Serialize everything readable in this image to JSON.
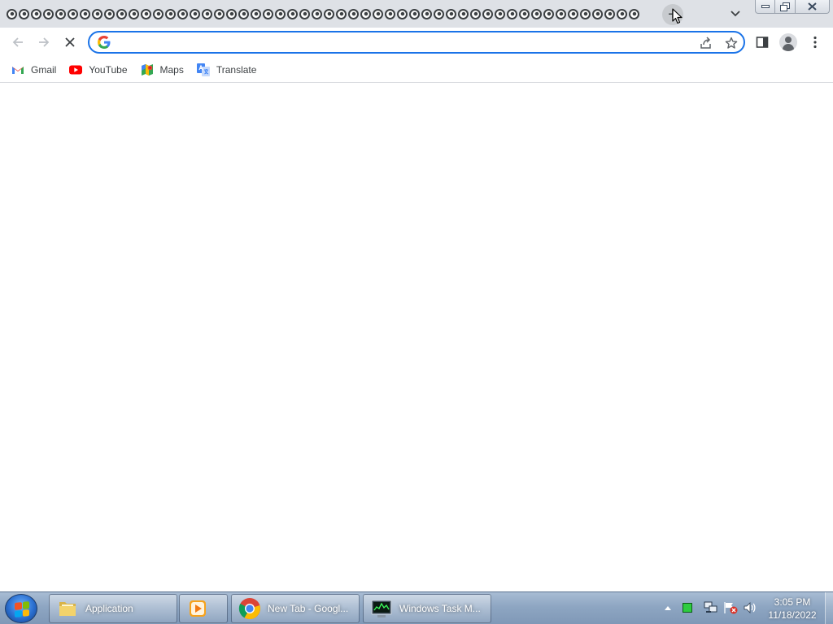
{
  "browser": {
    "tab_count": 52,
    "tab_icon": "tab-favicon-icon",
    "newtab_label": "+",
    "omnibox": {
      "value": "",
      "placeholder": ""
    },
    "colors": {
      "omnibox_focus": "#1a73e8",
      "tabstrip_bg": "#dee1e6"
    }
  },
  "bookmarks": [
    {
      "label": "Gmail",
      "icon": "gmail-icon"
    },
    {
      "label": "YouTube",
      "icon": "youtube-icon"
    },
    {
      "label": "Maps",
      "icon": "maps-icon"
    },
    {
      "label": "Translate",
      "icon": "translate-icon"
    }
  ],
  "taskbar": {
    "buttons": [
      {
        "label": "Application",
        "icon": "folder-icon"
      },
      {
        "label": "",
        "icon": "media-player-icon"
      },
      {
        "label": "New Tab - Googl...",
        "icon": "chrome-icon"
      },
      {
        "label": "Windows Task M...",
        "icon": "task-manager-icon"
      }
    ],
    "clock": {
      "time": "3:05 PM",
      "date": "11/18/2022"
    }
  }
}
